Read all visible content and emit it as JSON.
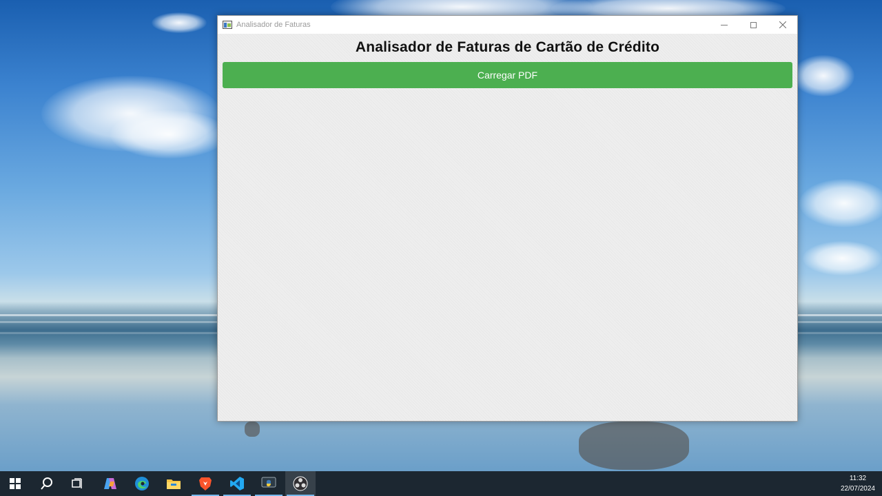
{
  "window": {
    "title": "Analisador de Faturas",
    "controls": {
      "minimize": "minimize-icon",
      "maximize": "maximize-icon",
      "close": "close-icon"
    }
  },
  "main": {
    "heading": "Analisador de Faturas de Cartão de Crédito",
    "load_button_label": "Carregar PDF",
    "load_button_color": "#4caf50"
  },
  "taskbar": {
    "items": [
      {
        "icon": "windows-start-icon"
      },
      {
        "icon": "search-icon"
      },
      {
        "icon": "task-view-icon"
      },
      {
        "icon": "copilot-icon"
      },
      {
        "icon": "edge-browser-icon"
      },
      {
        "icon": "file-explorer-icon"
      },
      {
        "icon": "brave-browser-icon"
      },
      {
        "icon": "vscode-icon"
      },
      {
        "icon": "python-icon"
      },
      {
        "icon": "obs-studio-icon"
      }
    ],
    "clock": {
      "time": "11:32",
      "date": "22/07/2024"
    }
  }
}
